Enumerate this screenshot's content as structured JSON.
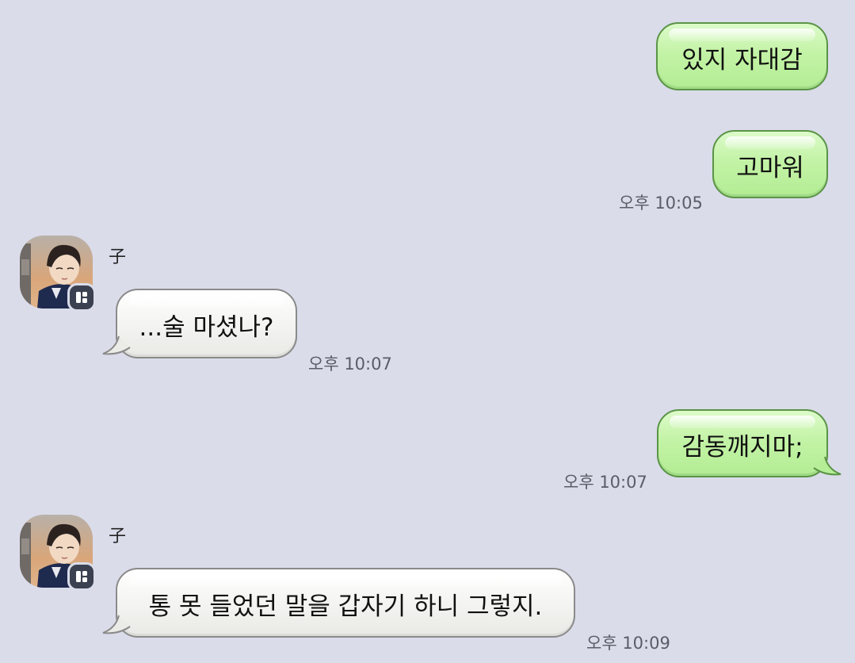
{
  "messages": [
    {
      "direction": "out",
      "text": "있지 자대감",
      "time": ""
    },
    {
      "direction": "out",
      "text": "고마워",
      "time": "오후 10:05"
    },
    {
      "direction": "in",
      "sender": "子",
      "text": "...술 마셨나?",
      "time": "오후 10:07"
    },
    {
      "direction": "out",
      "text": "감동깨지마;",
      "time": "오후 10:07"
    },
    {
      "direction": "in",
      "sender": "子",
      "text": "통 못 들었던 말을 갑자기 하니 그렇지.",
      "time": "오후 10:09"
    }
  ],
  "avatar": {
    "icon": "profile-photo",
    "badge_icon": "app-badge-icon"
  },
  "colors": {
    "background": "#dadcea",
    "outgoing_bubble": "#c3f3a6",
    "outgoing_border": "#5a9446",
    "incoming_bubble": "#f4f4f2",
    "incoming_border": "#8a8a8a",
    "timestamp": "#5a5c66"
  }
}
